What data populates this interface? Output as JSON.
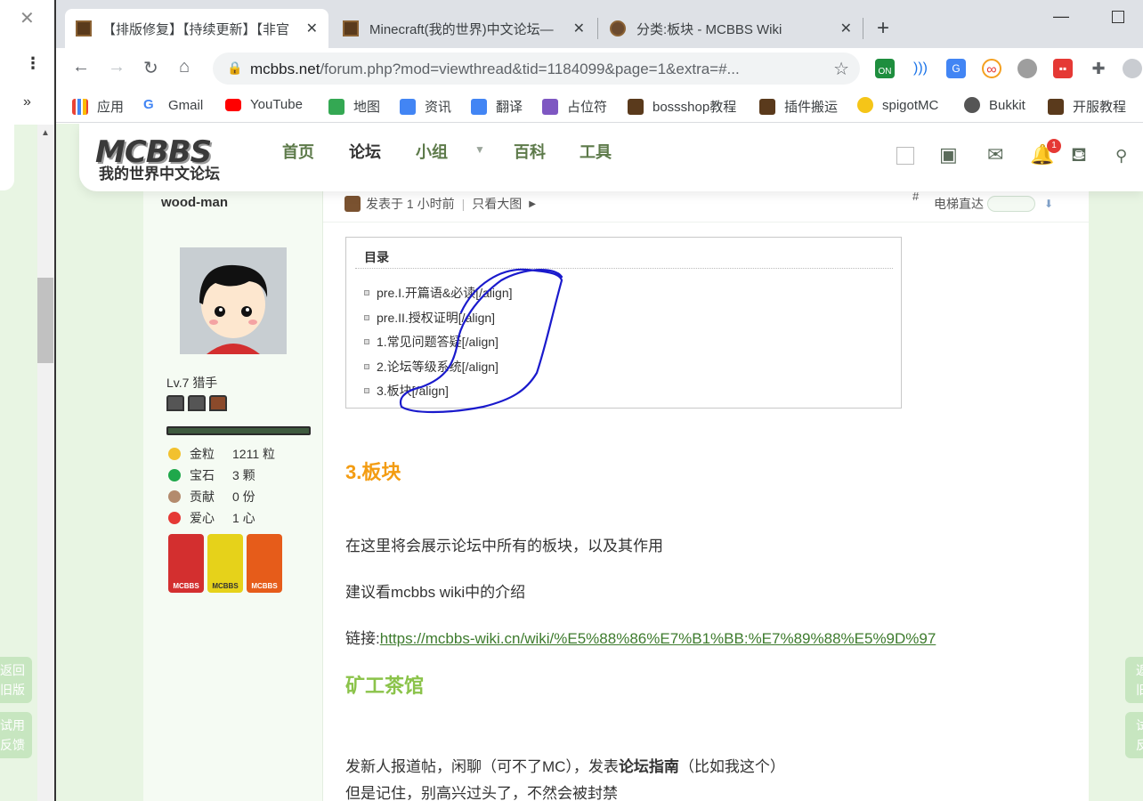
{
  "background_window": {
    "close_glyph": "✕",
    "menu_glyph": "⋮",
    "overflow_glyph": "»",
    "side_buttons": [
      {
        "line1": "返回",
        "line2": "旧版"
      },
      {
        "line1": "试用",
        "line2": "反馈"
      }
    ]
  },
  "tabs": [
    {
      "title": "【排版修复】【持续更新】【非官",
      "active": true
    },
    {
      "title": "Minecraft(我的世界)中文论坛—",
      "active": false
    },
    {
      "title": "分类:板块 - MCBBS Wiki",
      "active": false
    }
  ],
  "tab_close_glyph": "✕",
  "new_tab_glyph": "+",
  "window_controls": {
    "minimize": "—"
  },
  "omnibox": {
    "host": "mcbbs.net",
    "path": "/forum.php?mod=viewthread&tid=1184099&page=1&extra=#..."
  },
  "extension_on_label": "ON",
  "bookmarks": [
    {
      "label": "应用",
      "color": "#ea4335"
    },
    {
      "label": "Gmail",
      "color": "#4285f4"
    },
    {
      "label": "YouTube",
      "color": "#ff0000"
    },
    {
      "label": "地图",
      "color": "#34a853"
    },
    {
      "label": "资讯",
      "color": "#4285f4"
    },
    {
      "label": "翻译",
      "color": "#4285f4"
    },
    {
      "label": "占位符",
      "color": "#7e57c2"
    },
    {
      "label": "bossshop教程",
      "color": "#5a3a1c"
    },
    {
      "label": "插件搬运",
      "color": "#5a3a1c"
    },
    {
      "label": "spigotMC",
      "color": "#f5c518"
    },
    {
      "label": "Bukkit",
      "color": "#555555"
    },
    {
      "label": "开服教程",
      "color": "#5a3a1c"
    }
  ],
  "site_header": {
    "logo_line1": "MCBBS",
    "logo_line2": "我的世界中文论坛",
    "nav": [
      {
        "label": "首页",
        "current": false
      },
      {
        "label": "论坛",
        "current": true
      },
      {
        "label": "小组",
        "current": false
      },
      {
        "label": "百科",
        "current": false
      },
      {
        "label": "工具",
        "current": false
      }
    ],
    "notification_count": "1"
  },
  "author": {
    "name": "wood-man",
    "level": "Lv.7 猎手",
    "exp_fraction": 1.0,
    "stats": [
      {
        "label": "金粒",
        "value": "1211 粒",
        "color": "#f2c12e"
      },
      {
        "label": "宝石",
        "value": "3 颗",
        "color": "#1fa84b"
      },
      {
        "label": "贡献",
        "value": "0 份",
        "color": "#b38b6d"
      },
      {
        "label": "爱心",
        "value": "1 心",
        "color": "#e53935"
      }
    ],
    "medals": [
      {
        "label": "MCBBS",
        "color": "#d32f2f"
      },
      {
        "label": "MCBBS",
        "color": "#e6d21a"
      },
      {
        "label": "MCBBS",
        "color": "#e65c1a"
      }
    ]
  },
  "post_meta": {
    "posted": "发表于 1 小时前",
    "separator": "|",
    "only_author": "只看大图",
    "floor_hash": "#",
    "elevator": "电梯直达"
  },
  "toc": {
    "title": "目录",
    "items": [
      "pre.I.开篇语&必读[/align]",
      "pre.II.授权证明[/align]",
      "1.常见问题答疑[/align]",
      "2.论坛等级系统[/align]",
      "3.板块[/align]"
    ]
  },
  "content": {
    "section_title": "3.板块",
    "p1": "在这里将会展示论坛中所有的板块，以及其作用",
    "p2": "建议看mcbbs wiki中的介绍",
    "link_prefix": "链接:",
    "link": "https://mcbbs-wiki.cn/wiki/%E5%88%86%E7%B1%BB:%E7%89%88%E5%9D%97",
    "subsection_title": "矿工茶馆",
    "p3_before": "发新人报道帖，闲聊（可不了MC），发表",
    "p3_bold": "论坛指南",
    "p3_after": "（比如我这个）",
    "p4": "但是记住，别高兴过头了，不然会被封禁"
  },
  "right_side_buttons": [
    {
      "line1": "返",
      "line2": "旧"
    },
    {
      "line1": "试",
      "line2": "反"
    }
  ],
  "colors": {
    "page_bg": "#e8f5e3",
    "orange_heading": "#f39c12",
    "green_heading": "#8bc34a",
    "link": "#3d7b2d",
    "scribble": "#1a1acc"
  }
}
